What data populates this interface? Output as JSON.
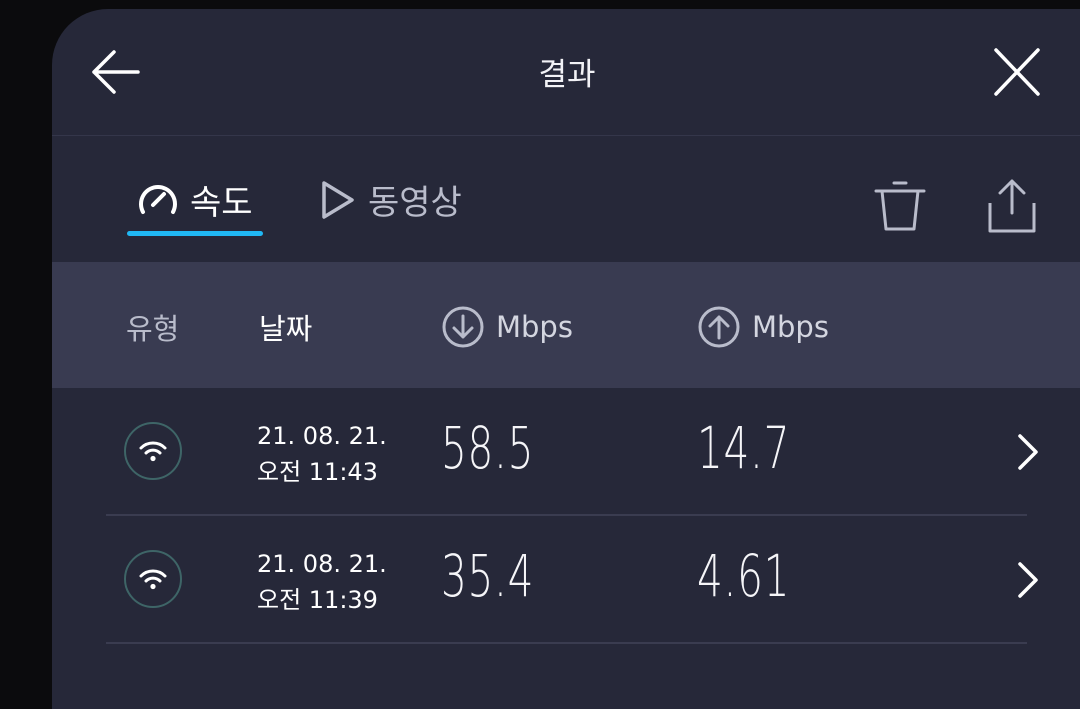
{
  "header": {
    "title": "결과",
    "back_icon": "arrow-left-icon",
    "close_icon": "close-icon"
  },
  "tabs": [
    {
      "label": "속도",
      "icon": "speedometer-icon",
      "active": true
    },
    {
      "label": "동영상",
      "icon": "play-icon",
      "active": false
    }
  ],
  "toolbar": {
    "delete_icon": "trash-icon",
    "share_icon": "share-icon"
  },
  "table": {
    "columns": {
      "type": "유형",
      "date": "날짜",
      "download": "Mbps",
      "upload": "Mbps"
    },
    "rows": [
      {
        "connection": "wifi-icon",
        "date": "21. 08. 21.",
        "time": "오전 11:43",
        "download": "58.5",
        "upload": "14.7"
      },
      {
        "connection": "wifi-icon",
        "date": "21. 08. 21.",
        "time": "오전 11:39",
        "download": "35.4",
        "upload": "4.61"
      }
    ]
  },
  "colors": {
    "background": "#262839",
    "header_row": "#393b51",
    "accent": "#20b8f5"
  }
}
